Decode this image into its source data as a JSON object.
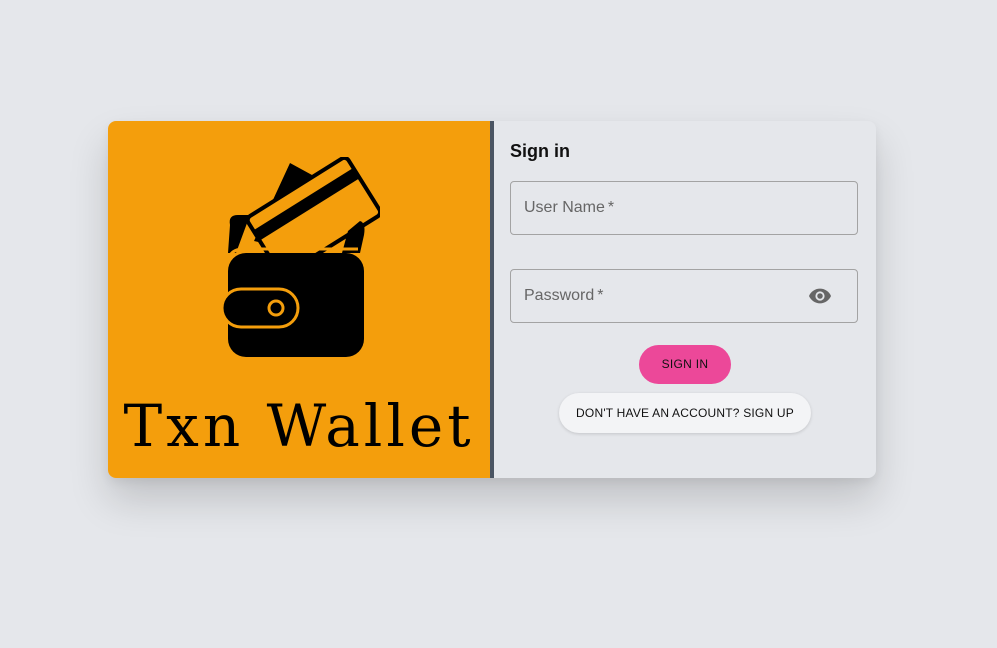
{
  "brand": {
    "name": "Txn Wallet",
    "color": "#f49e0c",
    "logo_icon": "wallet-with-cards-icon"
  },
  "form": {
    "title": "Sign in",
    "username": {
      "label": "User Name",
      "required_mark": "*",
      "value": ""
    },
    "password": {
      "label": "Password",
      "required_mark": "*",
      "value": "",
      "toggle_icon": "eye-icon"
    },
    "sign_in_label": "SIGN IN",
    "sign_up_label": "DON'T HAVE AN ACCOUNT? SIGN UP"
  },
  "colors": {
    "primary_button": "#ec4899",
    "divider": "#4b5563",
    "background": "#e5e7eb"
  }
}
